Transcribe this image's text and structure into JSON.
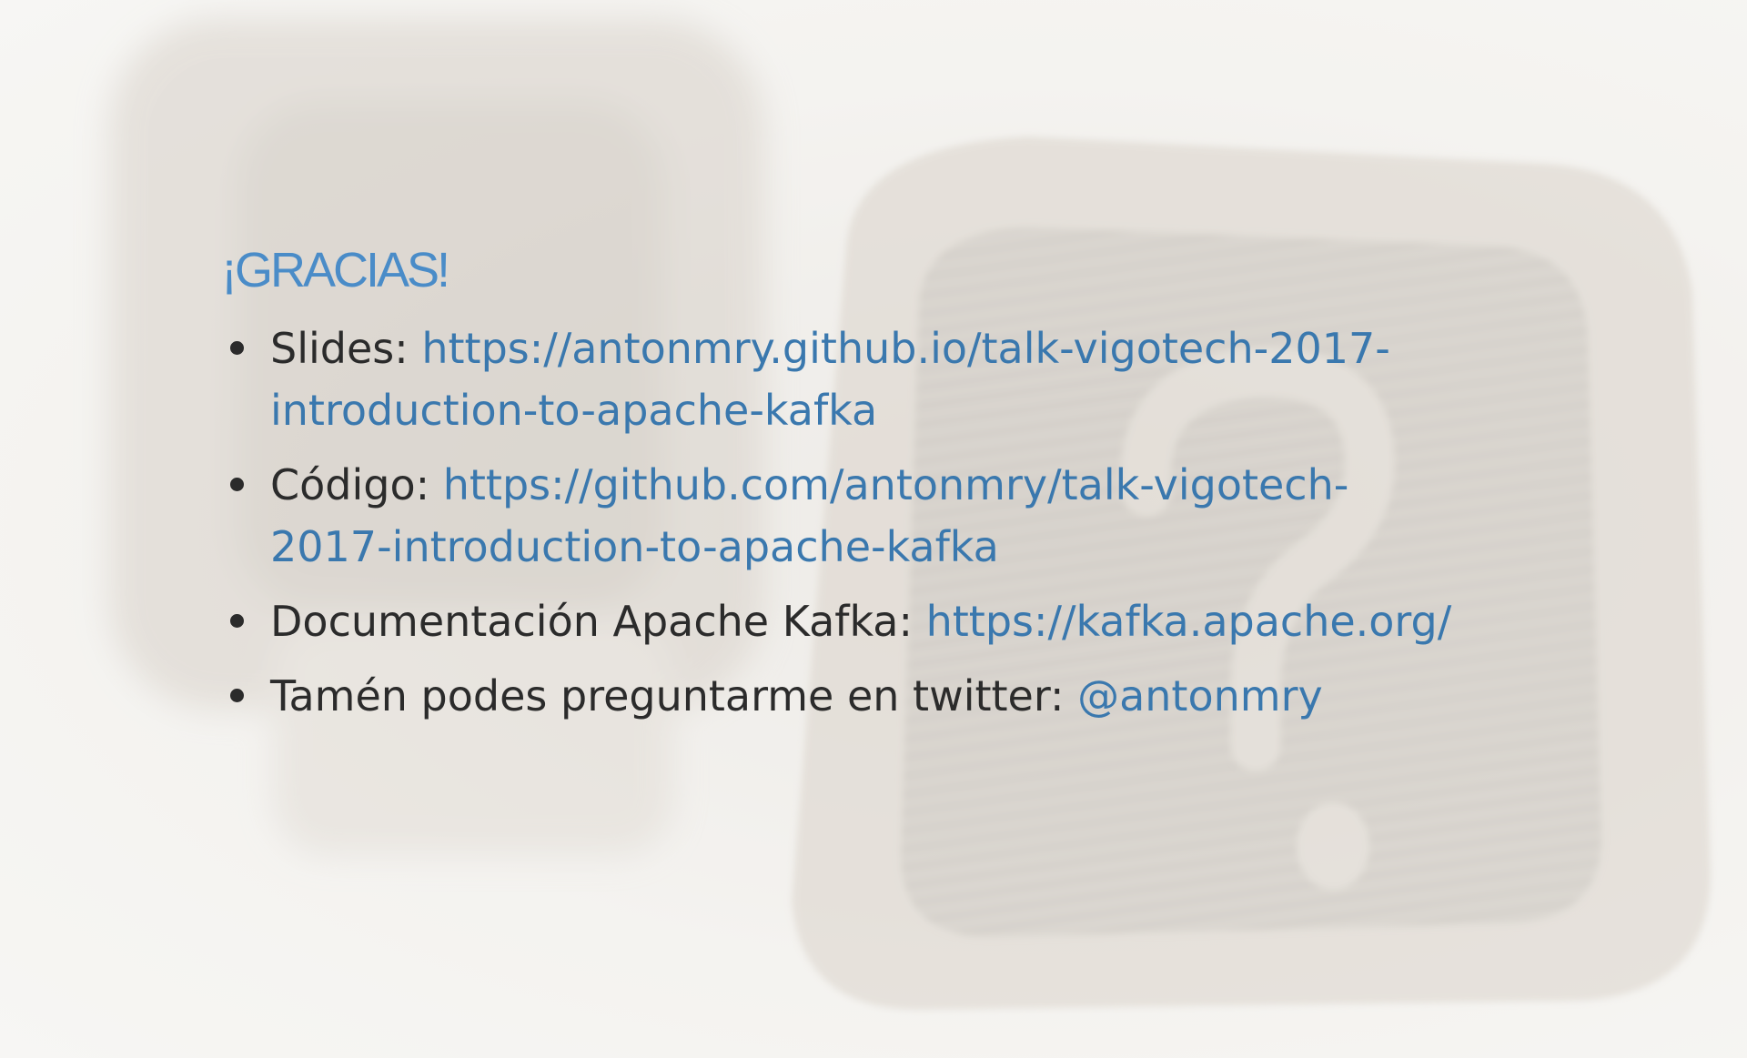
{
  "title": "¡GRACIAS!",
  "items": [
    {
      "label": "Slides: ",
      "link": "https://antonmry.github.io/talk-vigotech-2017-introduction-to-apache-kafka",
      "link_line1": "https://antonmry.github.io/talk-vigotech-2017-",
      "link_line2": "introduction-to-apache-kafka"
    },
    {
      "label": "Código: ",
      "link": "https://github.com/antonmry/talk-vigotech-2017-introduction-to-apache-kafka",
      "link_line1": "https://github.com/antonmry/talk-vigotech-",
      "link_line2": "2017-introduction-to-apache-kafka"
    },
    {
      "label": "Documentación Apache Kafka: ",
      "link": "https://kafka.apache.org/"
    },
    {
      "label": "Tamén podes preguntarme en twitter: ",
      "link": "@antonmry"
    }
  ],
  "colors": {
    "title": "#4a8cc8",
    "link": "#3a78ae",
    "text": "#2b2b2b",
    "background": "#f4f3f1"
  },
  "background_image": "question-mark-stamp-photo"
}
